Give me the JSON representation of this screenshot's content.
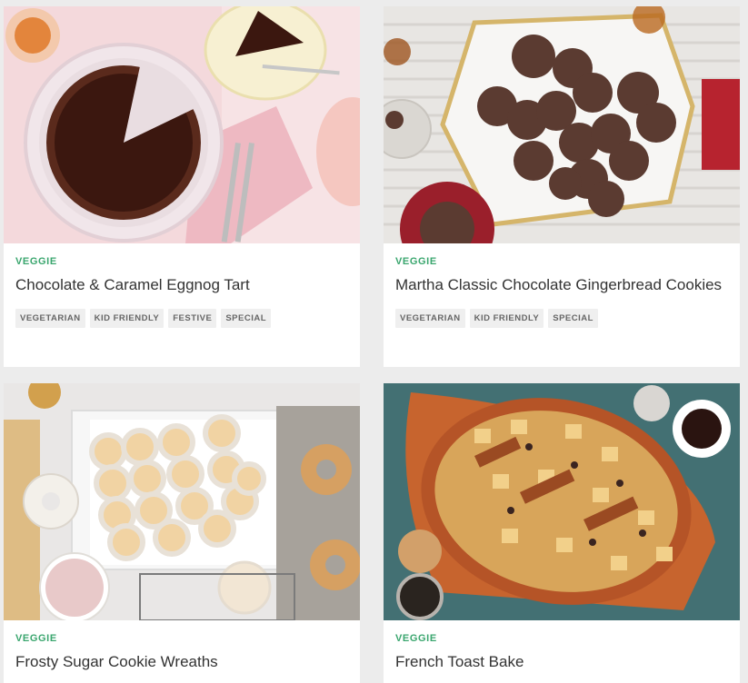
{
  "colors": {
    "category": "#3aa66e",
    "tag_bg": "#efefef",
    "page_bg": "#ececec"
  },
  "cards": [
    {
      "image": "chocolate-caramel-tart-photo",
      "category": "VEGGIE",
      "title": "Chocolate & Caramel Eggnog Tart",
      "tags": [
        "VEGETARIAN",
        "KID FRIENDLY",
        "FESTIVE",
        "SPECIAL"
      ]
    },
    {
      "image": "chocolate-gingerbread-cookies-photo",
      "category": "VEGGIE",
      "title": "Martha Classic Chocolate Gingerbread Cookies",
      "tags": [
        "VEGETARIAN",
        "KID FRIENDLY",
        "SPECIAL"
      ]
    },
    {
      "image": "sugar-cookie-wreaths-photo",
      "category": "VEGGIE",
      "title": "Frosty Sugar Cookie Wreaths",
      "tags": []
    },
    {
      "image": "french-toast-bake-photo",
      "category": "VEGGIE",
      "title": "French Toast Bake",
      "tags": []
    }
  ]
}
